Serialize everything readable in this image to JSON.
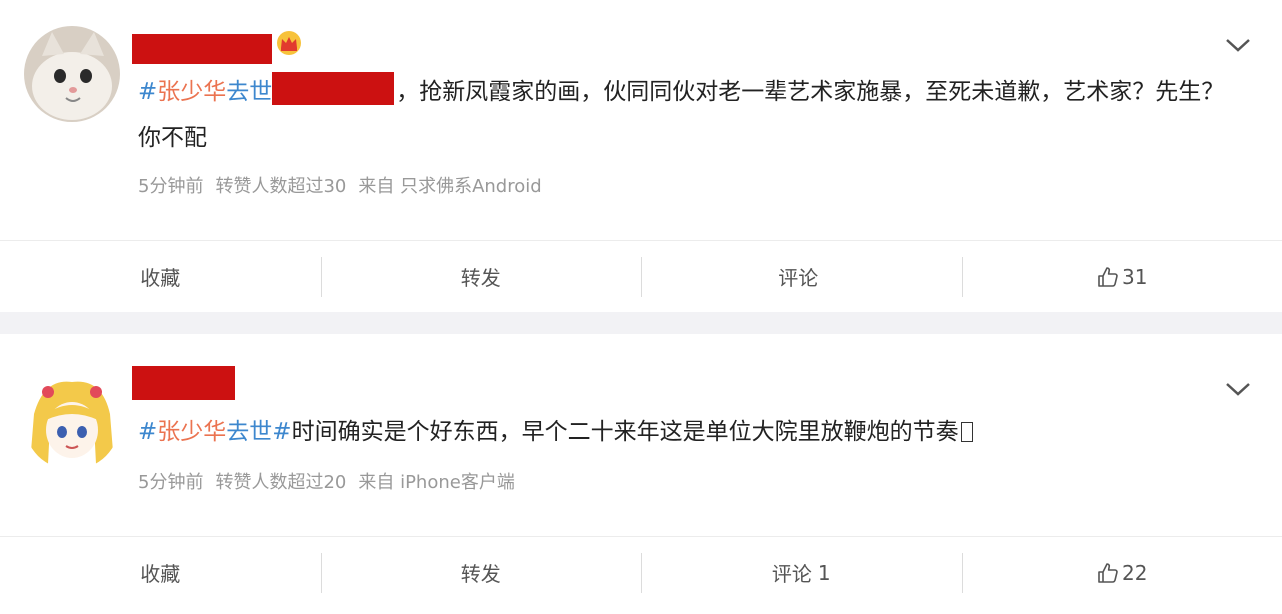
{
  "posts": [
    {
      "topic": {
        "hash_open": "#",
        "name_red": "张少华",
        "name_blue": "去世"
      },
      "text_main": "，抢新凤霞家的画，伙同同伙对老一辈艺术家施暴，至死未道歉，艺术家？先生？你不配",
      "meta": {
        "time": "5分钟前",
        "reposts": "转赞人数超过30",
        "source": "来自 只求佛系Android"
      },
      "actions": {
        "favorite": "收藏",
        "repost": "转发",
        "comment": "评论",
        "comment_count": "",
        "like_count": "31"
      }
    },
    {
      "topic": {
        "hash_open": "#",
        "name_red": "张少华",
        "name_blue": "去世",
        "hash_close": "#"
      },
      "text_main": "时间确实是个好东西，早个二十来年这是单位大院里放鞭炮的节奏",
      "meta": {
        "time": "5分钟前",
        "reposts": "转赞人数超过20",
        "source": "来自 iPhone客户端"
      },
      "actions": {
        "favorite": "收藏",
        "repost": "转发",
        "comment": "评论",
        "comment_count": "1",
        "like_count": "22"
      }
    }
  ],
  "colors": {
    "topic_red": "#eb7350",
    "topic_blue": "#3d87ce",
    "redaction": "#cc1111"
  },
  "icons": [
    "crown-icon",
    "chevron-down-icon",
    "thumbs-up-icon"
  ]
}
